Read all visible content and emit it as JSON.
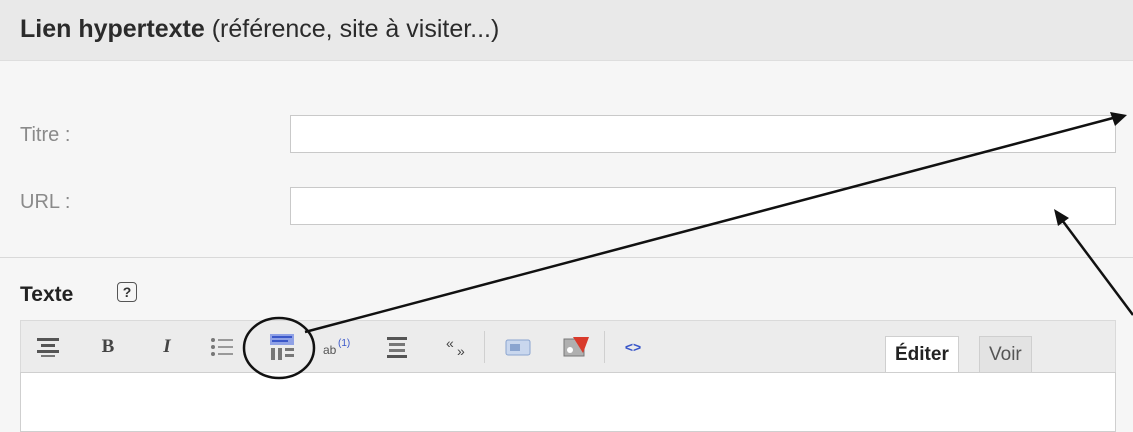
{
  "header": {
    "title_bold": "Lien hypertexte",
    "title_rest": "(référence, site à visiter...)"
  },
  "form": {
    "title_label": "Titre :",
    "title_value": "",
    "url_label": "URL :",
    "url_value": ""
  },
  "text_section": {
    "label": "Texte",
    "help_glyph": "?"
  },
  "toolbar": {
    "icons": [
      "align-center-icon",
      "bold-icon",
      "italic-icon",
      "bullet-list-icon",
      "footnote-icon",
      "superscript-icon",
      "align-justify-icon",
      "quote-icon",
      "image-icon",
      "media-icon",
      "code-icon"
    ],
    "bold_glyph": "B",
    "italic_glyph": "I",
    "sup_glyph": "(1)",
    "code_glyph": "<>"
  },
  "tabs": {
    "edit": "Éditer",
    "view": "Voir"
  },
  "colors": {
    "header_bg": "#e9e9e9",
    "page_bg": "#f6f6f6",
    "accent_blue": "#3a57c9"
  }
}
